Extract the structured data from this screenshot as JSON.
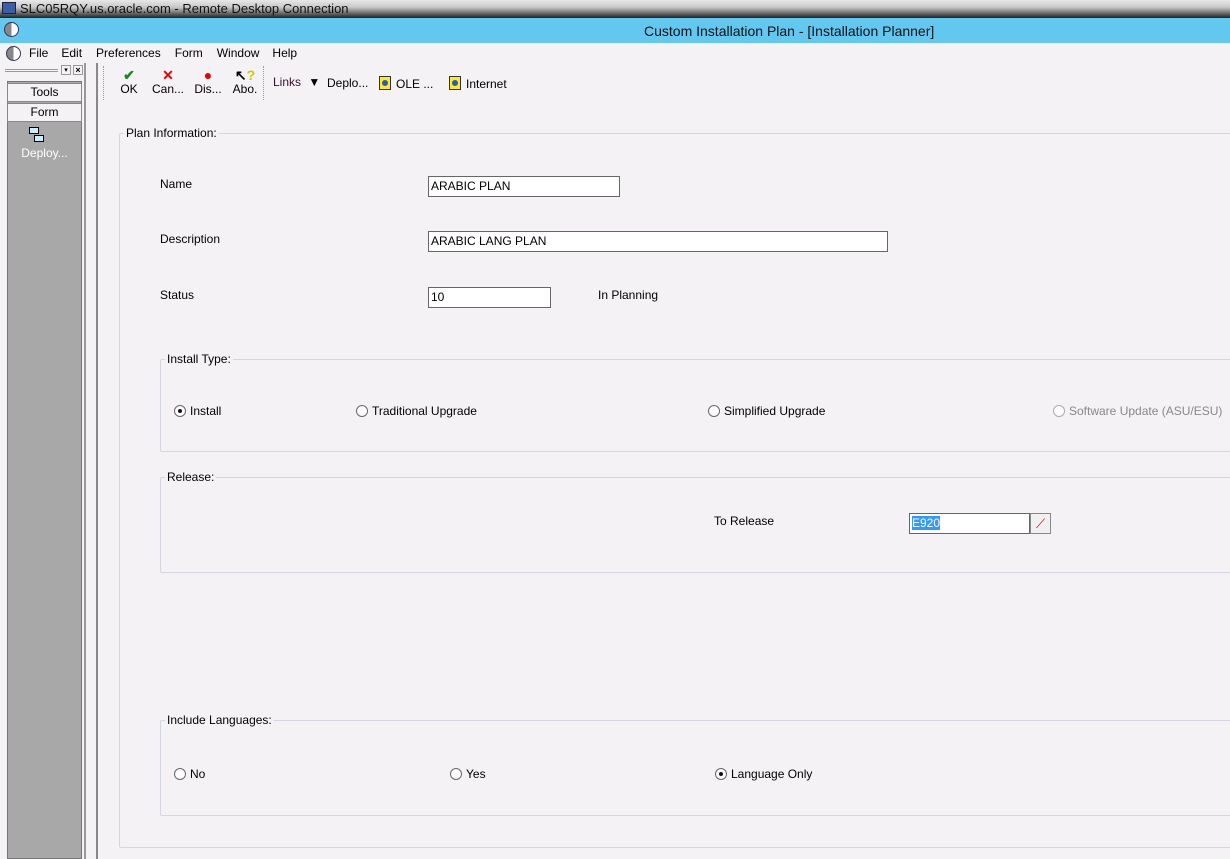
{
  "rdp_title": "SLC05RQY.us.oracle.com - Remote Desktop Connection",
  "app_title": "Custom Installation Plan - [Installation Planner]",
  "menu": [
    "File",
    "Edit",
    "Preferences",
    "Form",
    "Window",
    "Help"
  ],
  "left": {
    "tools": "Tools",
    "form": "Form",
    "deploy": "Deploy..."
  },
  "toolbar": {
    "ok": "OK",
    "cancel": "Can...",
    "display": "Dis...",
    "about": "Abo.",
    "links": "Links",
    "deploy": "Deplo...",
    "ole": "OLE ...",
    "internet": "Internet"
  },
  "form": {
    "plan_info": "Plan Information:",
    "name_label": "Name",
    "name_value": "ARABIC PLAN",
    "desc_label": "Description",
    "desc_value": "ARABIC LANG PLAN",
    "status_label": "Status",
    "status_value": "10",
    "status_text": "In Planning",
    "install_type": {
      "legend": "Install Type:",
      "options": [
        "Install",
        "Traditional Upgrade",
        "Simplified Upgrade",
        "Software Update (ASU/ESU)"
      ],
      "selected": "Install",
      "disabled": [
        "Software Update (ASU/ESU)"
      ]
    },
    "release": {
      "legend": "Release:",
      "to_label": "To Release",
      "to_value": "E920"
    },
    "languages": {
      "legend": "Include Languages:",
      "options": [
        "No",
        "Yes",
        "Language Only"
      ],
      "selected": "Language Only"
    }
  }
}
